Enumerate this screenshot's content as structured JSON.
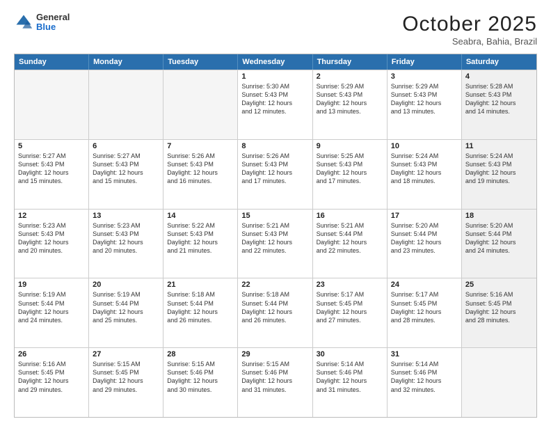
{
  "header": {
    "logo": {
      "general": "General",
      "blue": "Blue"
    },
    "title": "October 2025",
    "subtitle": "Seabra, Bahia, Brazil"
  },
  "days": [
    "Sunday",
    "Monday",
    "Tuesday",
    "Wednesday",
    "Thursday",
    "Friday",
    "Saturday"
  ],
  "weeks": [
    [
      {
        "day": "",
        "text": "",
        "empty": true
      },
      {
        "day": "",
        "text": "",
        "empty": true
      },
      {
        "day": "",
        "text": "",
        "empty": true
      },
      {
        "day": "1",
        "text": "Sunrise: 5:30 AM\nSunset: 5:43 PM\nDaylight: 12 hours\nand 12 minutes."
      },
      {
        "day": "2",
        "text": "Sunrise: 5:29 AM\nSunset: 5:43 PM\nDaylight: 12 hours\nand 13 minutes."
      },
      {
        "day": "3",
        "text": "Sunrise: 5:29 AM\nSunset: 5:43 PM\nDaylight: 12 hours\nand 13 minutes."
      },
      {
        "day": "4",
        "text": "Sunrise: 5:28 AM\nSunset: 5:43 PM\nDaylight: 12 hours\nand 14 minutes.",
        "shaded": true
      }
    ],
    [
      {
        "day": "5",
        "text": "Sunrise: 5:27 AM\nSunset: 5:43 PM\nDaylight: 12 hours\nand 15 minutes."
      },
      {
        "day": "6",
        "text": "Sunrise: 5:27 AM\nSunset: 5:43 PM\nDaylight: 12 hours\nand 15 minutes."
      },
      {
        "day": "7",
        "text": "Sunrise: 5:26 AM\nSunset: 5:43 PM\nDaylight: 12 hours\nand 16 minutes."
      },
      {
        "day": "8",
        "text": "Sunrise: 5:26 AM\nSunset: 5:43 PM\nDaylight: 12 hours\nand 17 minutes."
      },
      {
        "day": "9",
        "text": "Sunrise: 5:25 AM\nSunset: 5:43 PM\nDaylight: 12 hours\nand 17 minutes."
      },
      {
        "day": "10",
        "text": "Sunrise: 5:24 AM\nSunset: 5:43 PM\nDaylight: 12 hours\nand 18 minutes."
      },
      {
        "day": "11",
        "text": "Sunrise: 5:24 AM\nSunset: 5:43 PM\nDaylight: 12 hours\nand 19 minutes.",
        "shaded": true
      }
    ],
    [
      {
        "day": "12",
        "text": "Sunrise: 5:23 AM\nSunset: 5:43 PM\nDaylight: 12 hours\nand 20 minutes."
      },
      {
        "day": "13",
        "text": "Sunrise: 5:23 AM\nSunset: 5:43 PM\nDaylight: 12 hours\nand 20 minutes."
      },
      {
        "day": "14",
        "text": "Sunrise: 5:22 AM\nSunset: 5:43 PM\nDaylight: 12 hours\nand 21 minutes."
      },
      {
        "day": "15",
        "text": "Sunrise: 5:21 AM\nSunset: 5:43 PM\nDaylight: 12 hours\nand 22 minutes."
      },
      {
        "day": "16",
        "text": "Sunrise: 5:21 AM\nSunset: 5:44 PM\nDaylight: 12 hours\nand 22 minutes."
      },
      {
        "day": "17",
        "text": "Sunrise: 5:20 AM\nSunset: 5:44 PM\nDaylight: 12 hours\nand 23 minutes."
      },
      {
        "day": "18",
        "text": "Sunrise: 5:20 AM\nSunset: 5:44 PM\nDaylight: 12 hours\nand 24 minutes.",
        "shaded": true
      }
    ],
    [
      {
        "day": "19",
        "text": "Sunrise: 5:19 AM\nSunset: 5:44 PM\nDaylight: 12 hours\nand 24 minutes."
      },
      {
        "day": "20",
        "text": "Sunrise: 5:19 AM\nSunset: 5:44 PM\nDaylight: 12 hours\nand 25 minutes."
      },
      {
        "day": "21",
        "text": "Sunrise: 5:18 AM\nSunset: 5:44 PM\nDaylight: 12 hours\nand 26 minutes."
      },
      {
        "day": "22",
        "text": "Sunrise: 5:18 AM\nSunset: 5:44 PM\nDaylight: 12 hours\nand 26 minutes."
      },
      {
        "day": "23",
        "text": "Sunrise: 5:17 AM\nSunset: 5:45 PM\nDaylight: 12 hours\nand 27 minutes."
      },
      {
        "day": "24",
        "text": "Sunrise: 5:17 AM\nSunset: 5:45 PM\nDaylight: 12 hours\nand 28 minutes."
      },
      {
        "day": "25",
        "text": "Sunrise: 5:16 AM\nSunset: 5:45 PM\nDaylight: 12 hours\nand 28 minutes.",
        "shaded": true
      }
    ],
    [
      {
        "day": "26",
        "text": "Sunrise: 5:16 AM\nSunset: 5:45 PM\nDaylight: 12 hours\nand 29 minutes."
      },
      {
        "day": "27",
        "text": "Sunrise: 5:15 AM\nSunset: 5:45 PM\nDaylight: 12 hours\nand 29 minutes."
      },
      {
        "day": "28",
        "text": "Sunrise: 5:15 AM\nSunset: 5:46 PM\nDaylight: 12 hours\nand 30 minutes."
      },
      {
        "day": "29",
        "text": "Sunrise: 5:15 AM\nSunset: 5:46 PM\nDaylight: 12 hours\nand 31 minutes."
      },
      {
        "day": "30",
        "text": "Sunrise: 5:14 AM\nSunset: 5:46 PM\nDaylight: 12 hours\nand 31 minutes."
      },
      {
        "day": "31",
        "text": "Sunrise: 5:14 AM\nSunset: 5:46 PM\nDaylight: 12 hours\nand 32 minutes."
      },
      {
        "day": "",
        "text": "",
        "empty": true,
        "shaded": true
      }
    ]
  ]
}
